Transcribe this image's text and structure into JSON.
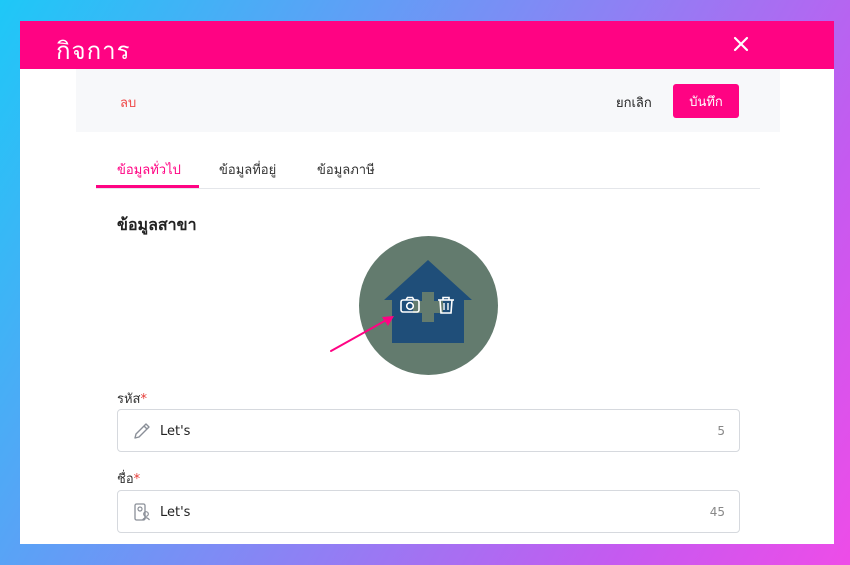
{
  "modal": {
    "title": "กิจการ"
  },
  "actions": {
    "delete_label": "ลบ",
    "cancel_label": "ยกเลิก",
    "save_label": "บันทึก"
  },
  "tabs": [
    {
      "label": "ข้อมูลทั่วไป",
      "active": true
    },
    {
      "label": "ข้อมูลที่อยู่",
      "active": false
    },
    {
      "label": "ข้อมูลภาษี",
      "active": false
    }
  ],
  "section": {
    "title": "ข้อมูลสาขา"
  },
  "avatar": {
    "icons": [
      "home-icon",
      "camera-icon",
      "trash-icon"
    ]
  },
  "fields": {
    "code": {
      "label": "รหัส",
      "required_mark": "*",
      "value": "Let's",
      "counter": "5",
      "icon": "pencil-icon"
    },
    "name": {
      "label": "ชื่อ",
      "required_mark": "*",
      "value": "Let's",
      "counter": "45",
      "icon": "id-badge-icon"
    }
  },
  "colors": {
    "brand": "#ff0383",
    "avatar_bg": "#637b6e",
    "house": "#1f4e79",
    "danger": "#ef4747"
  }
}
